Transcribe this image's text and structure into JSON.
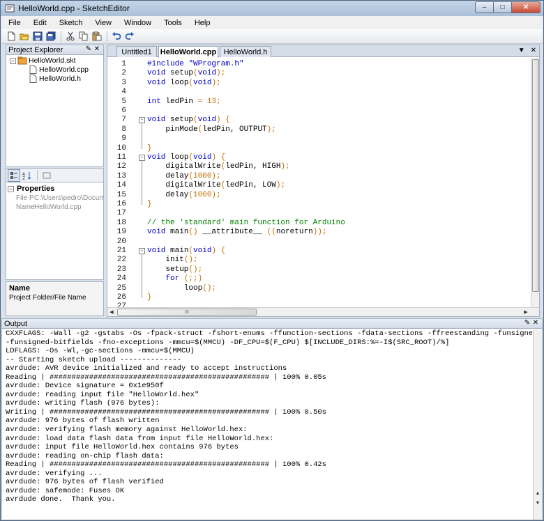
{
  "window": {
    "title": "HelloWorld.cpp - SketchEditor",
    "minimize": "–",
    "maximize": "□",
    "close": "✕"
  },
  "menu": [
    "File",
    "Edit",
    "Sketch",
    "View",
    "Window",
    "Tools",
    "Help"
  ],
  "toolbar_icons": [
    "new-file-icon",
    "open-folder-icon",
    "save-icon",
    "save-all-icon",
    "cut-icon",
    "copy-icon",
    "paste-icon",
    "undo-icon",
    "redo-icon"
  ],
  "project_explorer": {
    "title": "Project Explorer",
    "items": [
      {
        "label": "HelloWorld.skt",
        "type": "project"
      },
      {
        "label": "HelloWorld.cpp",
        "type": "file"
      },
      {
        "label": "HelloWorld.h",
        "type": "file"
      }
    ]
  },
  "properties": {
    "title": "Properties",
    "rows": [
      {
        "name": "File P",
        "value": "C:\\Users\\pedro\\Docume"
      },
      {
        "name": "Name",
        "value": "HelloWorld.cpp"
      }
    ],
    "description": {
      "name": "Name",
      "text": "Project Folder/File Name"
    }
  },
  "editor": {
    "tabs": [
      {
        "label": "Untitled1",
        "active": false
      },
      {
        "label": "HelloWorld.cpp",
        "active": true
      },
      {
        "label": "HelloWorld.h",
        "active": false
      }
    ],
    "lines": [
      {
        "n": "1",
        "parts": [
          [
            "kw",
            "#include "
          ],
          [
            "st",
            "\"WProgram.h\""
          ]
        ]
      },
      {
        "n": "2",
        "parts": [
          [
            "kw",
            "void "
          ],
          [
            "",
            "setup"
          ],
          [
            "op",
            "("
          ],
          [
            "kw",
            "void"
          ],
          [
            "op",
            ");"
          ]
        ]
      },
      {
        "n": "3",
        "parts": [
          [
            "kw",
            "void "
          ],
          [
            "",
            "loop"
          ],
          [
            "op",
            "("
          ],
          [
            "kw",
            "void"
          ],
          [
            "op",
            ");"
          ]
        ]
      },
      {
        "n": "4",
        "parts": []
      },
      {
        "n": "5",
        "parts": [
          [
            "kw",
            "int "
          ],
          [
            "",
            "ledPin "
          ],
          [
            "op",
            "= 13;"
          ]
        ]
      },
      {
        "n": "6",
        "parts": []
      },
      {
        "n": "7",
        "fold": "-",
        "parts": [
          [
            "kw",
            "void "
          ],
          [
            "",
            "setup"
          ],
          [
            "op",
            "("
          ],
          [
            "kw",
            "void"
          ],
          [
            "op",
            ") {"
          ]
        ]
      },
      {
        "n": "8",
        "parts": [
          [
            "",
            "    pinMode"
          ],
          [
            "op",
            "("
          ],
          [
            "",
            "ledPin, OUTPUT"
          ],
          [
            "op",
            ");"
          ]
        ]
      },
      {
        "n": "9",
        "parts": []
      },
      {
        "n": "10",
        "parts": [
          [
            "op",
            "}"
          ]
        ]
      },
      {
        "n": "11",
        "fold": "-",
        "parts": [
          [
            "kw",
            "void "
          ],
          [
            "",
            "loop"
          ],
          [
            "op",
            "("
          ],
          [
            "kw",
            "void"
          ],
          [
            "op",
            ") {"
          ]
        ]
      },
      {
        "n": "12",
        "parts": [
          [
            "",
            "    digitalWrite"
          ],
          [
            "op",
            "("
          ],
          [
            "",
            "ledPin, HIGH"
          ],
          [
            "op",
            ");"
          ]
        ]
      },
      {
        "n": "13",
        "parts": [
          [
            "",
            "    delay"
          ],
          [
            "op",
            "(1000);"
          ]
        ]
      },
      {
        "n": "14",
        "parts": [
          [
            "",
            "    digitalWrite"
          ],
          [
            "op",
            "("
          ],
          [
            "",
            "ledPin, LOW"
          ],
          [
            "op",
            ");"
          ]
        ]
      },
      {
        "n": "15",
        "parts": [
          [
            "",
            "    delay"
          ],
          [
            "op",
            "(1000);"
          ]
        ]
      },
      {
        "n": "16",
        "parts": [
          [
            "op",
            "}"
          ]
        ]
      },
      {
        "n": "17",
        "parts": []
      },
      {
        "n": "18",
        "parts": [
          [
            "cm",
            "// the 'standard' main function for Arduino"
          ]
        ]
      },
      {
        "n": "19",
        "parts": [
          [
            "kw",
            "void "
          ],
          [
            "",
            "main"
          ],
          [
            "op",
            "() "
          ],
          [
            "",
            "__attribute__ "
          ],
          [
            "op",
            "(("
          ],
          [
            "",
            "noreturn"
          ],
          [
            "op",
            "));"
          ]
        ]
      },
      {
        "n": "20",
        "parts": []
      },
      {
        "n": "21",
        "fold": "-",
        "parts": [
          [
            "kw",
            "void "
          ],
          [
            "",
            "main"
          ],
          [
            "op",
            "("
          ],
          [
            "kw",
            "void"
          ],
          [
            "op",
            ") {"
          ]
        ]
      },
      {
        "n": "22",
        "parts": [
          [
            "",
            "    init"
          ],
          [
            "op",
            "();"
          ]
        ]
      },
      {
        "n": "23",
        "parts": [
          [
            "",
            "    setup"
          ],
          [
            "op",
            "();"
          ]
        ]
      },
      {
        "n": "24",
        "parts": [
          [
            "kw",
            "    for "
          ],
          [
            "op",
            "(;;)"
          ]
        ]
      },
      {
        "n": "25",
        "parts": [
          [
            "",
            "        loop"
          ],
          [
            "op",
            "();"
          ]
        ]
      },
      {
        "n": "26",
        "parts": [
          [
            "op",
            "}"
          ]
        ]
      },
      {
        "n": "27",
        "parts": []
      }
    ],
    "hscroll_grip": "III"
  },
  "output": {
    "title": "Output",
    "lines": [
      "CXXFLAGS: -Wall -g2 -gstabs -Os -fpack-struct -fshort-enums -ffunction-sections -fdata-sections -ffreestanding -funsigned-char",
      "-funsigned-bitfields -fno-exceptions -mmcu=$(MMCU) -DF_CPU=$(F_CPU) $[INCLUDE_DIRS:%=-I$(SRC_ROOT)/%]",
      "LDFLAGS: -Os -Wl,-gc-sections -mmcu=$(MMCU)",
      "-- Starting sketch upload --------------",
      "avrdude: AVR device initialized and ready to accept instructions",
      "Reading | ################################################## | 100% 0.05s",
      "avrdude: Device signature = 0x1e950f",
      "avrdude: reading input file \"HelloWorld.hex\"",
      "avrdude: writing flash (976 bytes):",
      "Writing | ################################################## | 100% 0.50s",
      "avrdude: 976 bytes of flash written",
      "avrdude: verifying flash memory against HelloWorld.hex:",
      "avrdude: load data flash data from input file HelloWorld.hex:",
      "avrdude: input file HelloWorld.hex contains 976 bytes",
      "avrdude: reading on-chip flash data:",
      "Reading | ################################################## | 100% 0.42s",
      "avrdude: verifying ...",
      "avrdude: 976 bytes of flash verified",
      "avrdude: safemode: Fuses OK",
      "avrdude done.  Thank you."
    ]
  }
}
